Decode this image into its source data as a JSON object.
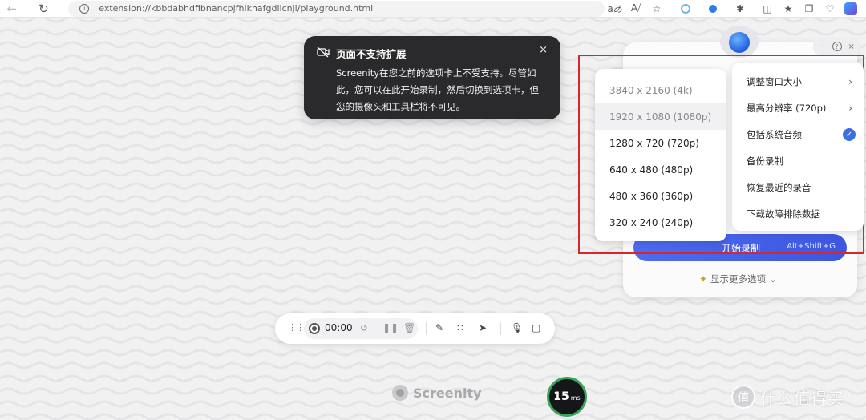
{
  "browser": {
    "url_prefix": "extension://",
    "url_path": "kbbdabhdfibnancpjfhlkhafgdilcnji/playground.html",
    "icons": [
      "back-icon",
      "reload-icon",
      "info-icon",
      "read-aloud-icon",
      "immersive-reader-icon",
      "favorite-icon",
      "screenity-extension-icon",
      "blue-extension-icon",
      "extensions-icon",
      "split-screen-icon",
      "favorites-icon",
      "collections-icon",
      "browser-essentials-icon",
      "copilot-icon"
    ]
  },
  "toast": {
    "title": "页面不支持扩展",
    "body": "Screenity在您之前的选项卡上不受支持。尽管如此，您可以在此开始录制，然后切换到选项卡，但您的摄像头和工具栏将不可见。",
    "close": "×"
  },
  "popup": {
    "start_label": "开始录制",
    "start_shortcut": "Alt+Shift+G",
    "more_options": "显示更多选项",
    "top_dots": "···",
    "help": "?",
    "close": "×"
  },
  "resolution_menu": {
    "items": [
      {
        "label": "3840 x 2160 (4k)",
        "state": "disabled"
      },
      {
        "label": "1920 x 1080 (1080p)",
        "state": "disabled-highlight"
      },
      {
        "label": "1280 x 720 (720p)",
        "state": "normal"
      },
      {
        "label": "640 x 480 (480p)",
        "state": "normal"
      },
      {
        "label": "480 x 360 (360p)",
        "state": "normal"
      },
      {
        "label": "320 x 240 (240p)",
        "state": "normal"
      }
    ]
  },
  "settings_menu": {
    "items": [
      {
        "label": "调整窗口大小",
        "suffix": "chevron"
      },
      {
        "label": "最高分辨率 (720p)",
        "suffix": "chevron"
      },
      {
        "label": "包括系统音频",
        "suffix": "check"
      },
      {
        "label": "备份录制",
        "suffix": ""
      },
      {
        "label": "恢复最近的录音",
        "suffix": ""
      },
      {
        "label": "下载故障排除数据",
        "suffix": ""
      }
    ]
  },
  "recording_toolbar": {
    "time": "00:00"
  },
  "logo": {
    "text": "Screenity"
  },
  "latency_badge": {
    "value": "15",
    "unit": "ms"
  },
  "watermark": {
    "text": "什么值得买",
    "sub": "SMYZ.NET"
  },
  "colors": {
    "accent": "#3d56e0",
    "highlight_border": "#d9262b",
    "toast_bg": "#2a2a2c",
    "badge_ring": "#3aa55a"
  }
}
